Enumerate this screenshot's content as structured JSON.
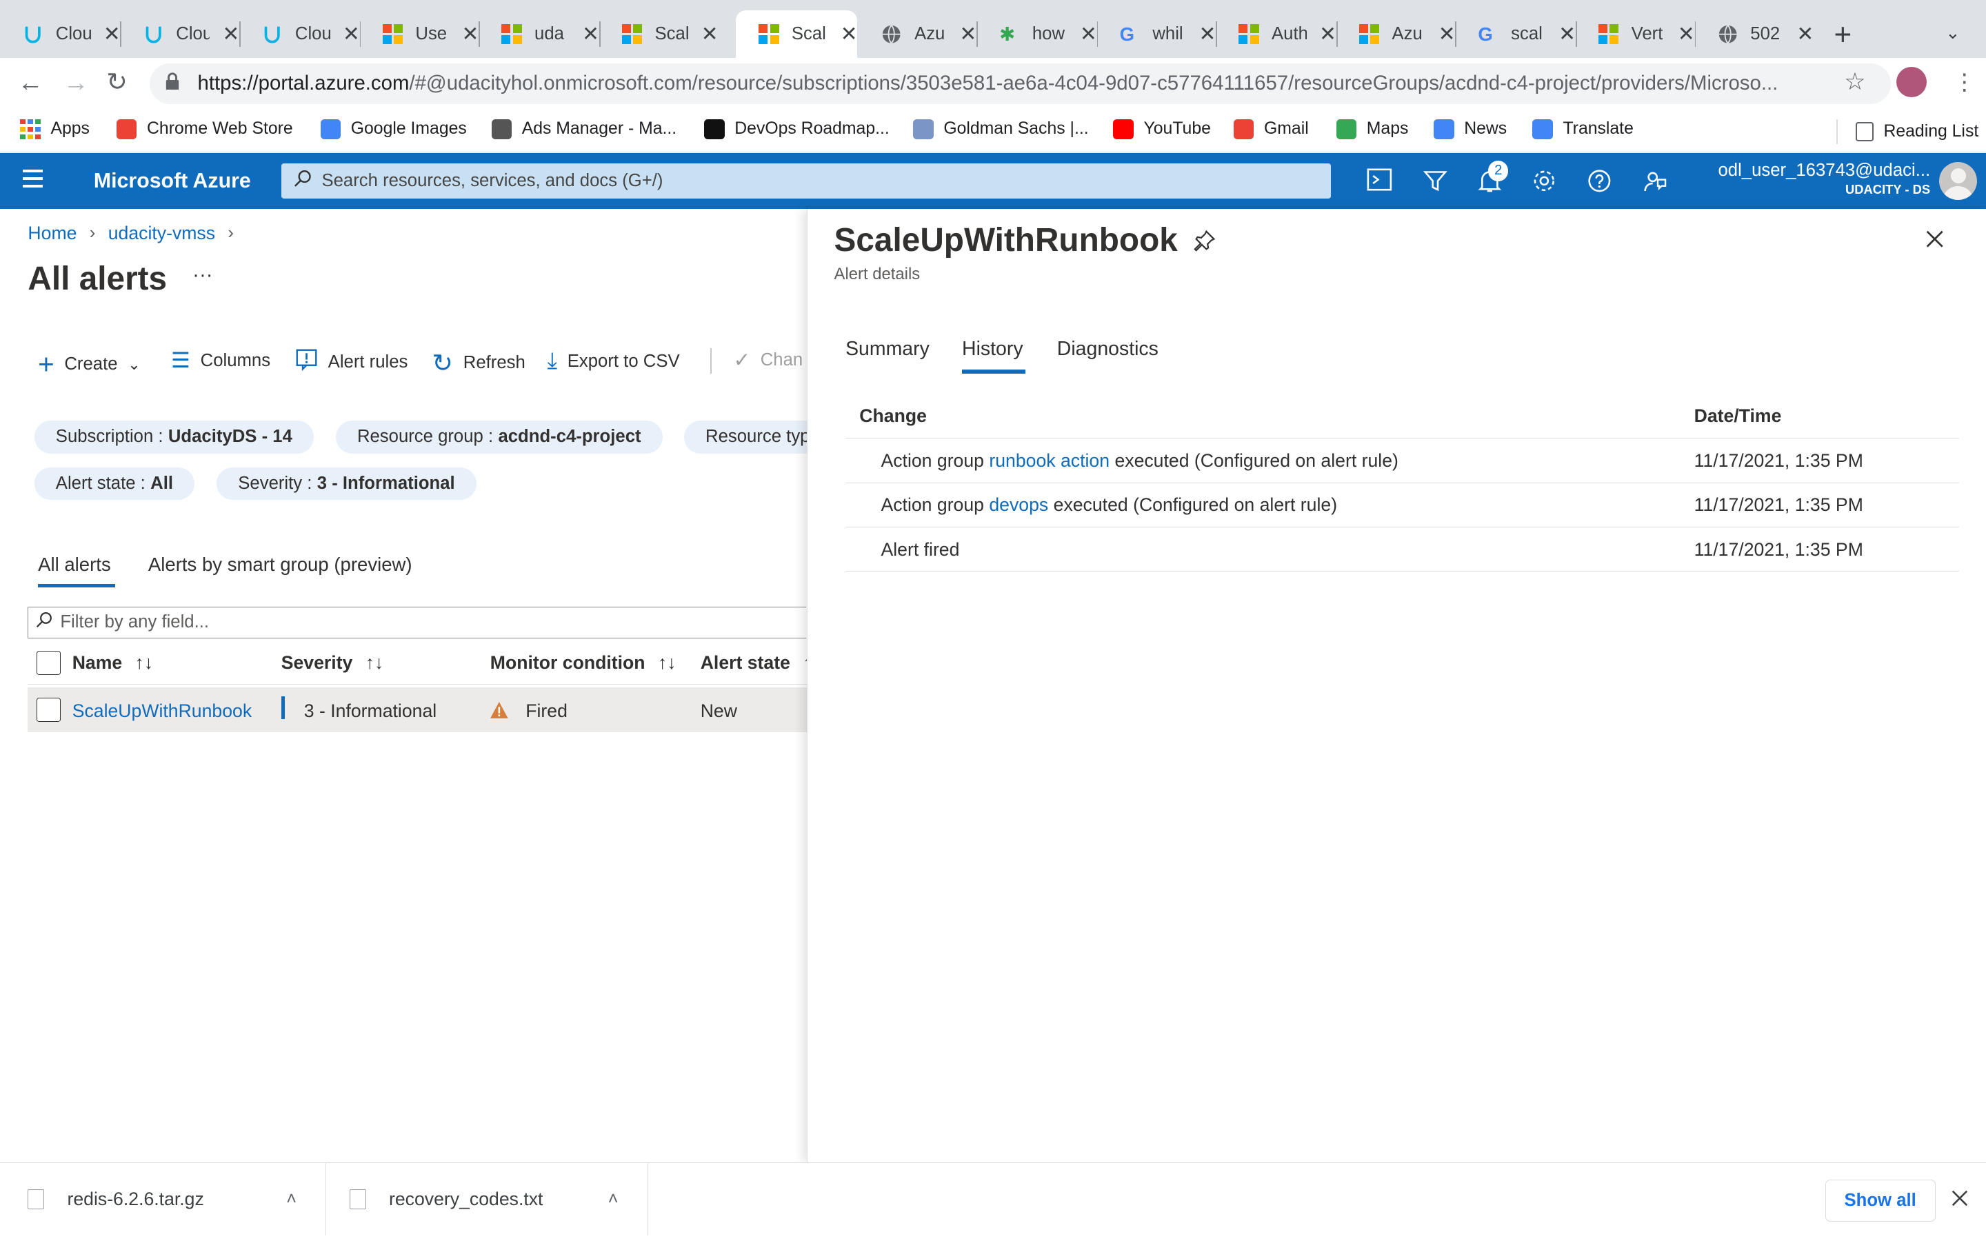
{
  "browser": {
    "tabs": [
      {
        "title": "Clou",
        "icon": "udacity-icon"
      },
      {
        "title": "Clou",
        "icon": "udacity-icon"
      },
      {
        "title": "Clou",
        "icon": "udacity-icon"
      },
      {
        "title": "Use",
        "icon": "microsoft-icon"
      },
      {
        "title": "uda",
        "icon": "microsoft-icon"
      },
      {
        "title": "Scal",
        "icon": "microsoft-icon"
      },
      {
        "title": "Scal",
        "icon": "microsoft-icon",
        "active": true
      },
      {
        "title": "Azu",
        "icon": "globe-icon"
      },
      {
        "title": "how",
        "icon": "star-icon"
      },
      {
        "title": "whil",
        "icon": "google-icon"
      },
      {
        "title": "Auth",
        "icon": "microsoft-icon"
      },
      {
        "title": "Azu",
        "icon": "microsoft-icon"
      },
      {
        "title": "scal",
        "icon": "google-icon"
      },
      {
        "title": "Vert",
        "icon": "microsoft-icon"
      },
      {
        "title": "502",
        "icon": "globe-icon"
      }
    ],
    "url_host": "https://portal.azure.com",
    "url_path": "/#@udacityhol.onmicrosoft.com/resource/subscriptions/3503e581-ae6a-4c04-9d07-c57764111657/resourceGroups/acdnd-c4-project/providers/Microso...",
    "bookmarks": [
      {
        "label": "Apps"
      },
      {
        "label": "Chrome Web Store"
      },
      {
        "label": "Google Images"
      },
      {
        "label": "Ads Manager - Ma..."
      },
      {
        "label": "DevOps Roadmap..."
      },
      {
        "label": "Goldman Sachs |..."
      },
      {
        "label": "YouTube"
      },
      {
        "label": "Gmail"
      },
      {
        "label": "Maps"
      },
      {
        "label": "News"
      },
      {
        "label": "Translate"
      }
    ],
    "reading_list": "Reading List"
  },
  "azure": {
    "brand": "Microsoft Azure",
    "search_placeholder": "Search resources, services, and docs (G+/)",
    "notification_count": "2",
    "user_name": "odl_user_163743@udaci...",
    "tenant": "UDACITY - DS",
    "accent": "#0f6cbd"
  },
  "blade": {
    "breadcrumb": [
      "Home",
      "udacity-vmss"
    ],
    "title": "All alerts",
    "more": "···",
    "commands": {
      "create": "Create",
      "columns": "Columns",
      "alert_rules": "Alert rules",
      "refresh": "Refresh",
      "export": "Export to CSV",
      "change": "Chan"
    },
    "filters": [
      {
        "key": "Subscription :",
        "value": "UdacityDS - 14"
      },
      {
        "key": "Resource group :",
        "value": "acdnd-c4-project"
      },
      {
        "key": "Resource typ",
        "value": ""
      },
      {
        "key": "Alert state :",
        "value": "All"
      },
      {
        "key": "Severity :",
        "value": "3 - Informational"
      }
    ],
    "tabs": [
      "All alerts",
      "Alerts by smart group (preview)"
    ],
    "filter_placeholder": "Filter by any field...",
    "columns": [
      "Name",
      "Severity",
      "Monitor condition",
      "Alert state"
    ],
    "rows": [
      {
        "name": "ScaleUpWithRunbook",
        "severity": "3 - Informational",
        "condition": "Fired",
        "state": "New"
      }
    ]
  },
  "details": {
    "title": "ScaleUpWithRunbook",
    "subtitle": "Alert details",
    "tabs": [
      "Summary",
      "History",
      "Diagnostics"
    ],
    "active_tab": "History",
    "col_change": "Change",
    "col_datetime": "Date/Time",
    "history": [
      {
        "prefix": "Action group ",
        "link": "runbook action",
        "suffix": " executed (Configured on alert rule)",
        "date": "11/17/2021, 1:35 PM"
      },
      {
        "prefix": "Action group ",
        "link": "devops",
        "suffix": " executed (Configured on alert rule)",
        "date": "11/17/2021, 1:35 PM"
      },
      {
        "prefix": "Alert fired",
        "link": "",
        "suffix": "",
        "date": "11/17/2021, 1:35 PM"
      }
    ]
  },
  "downloads": {
    "files": [
      "redis-6.2.6.tar.gz",
      "recovery_codes.txt"
    ],
    "show_all": "Show all"
  }
}
